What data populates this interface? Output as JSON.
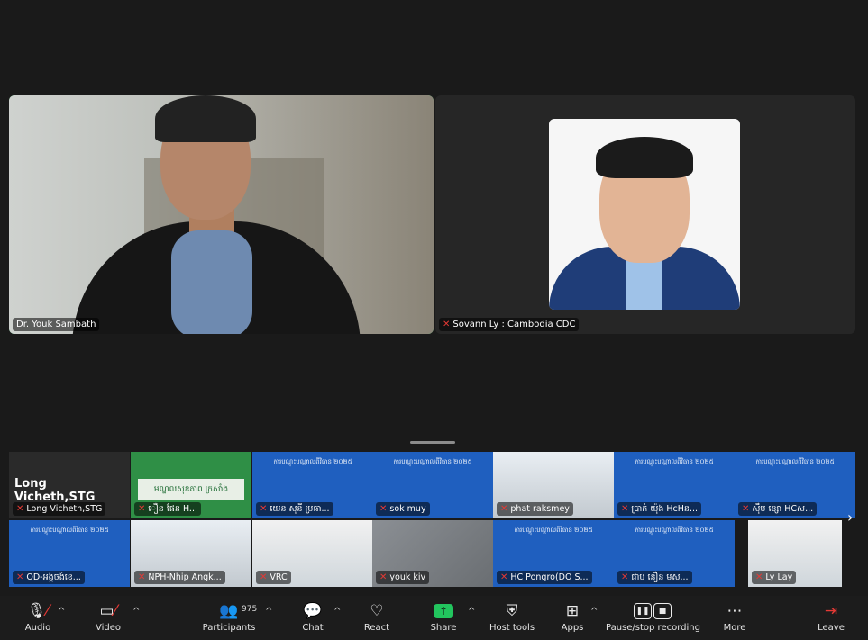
{
  "speakers": [
    {
      "name": "Dr. Youk Sambath",
      "active": true,
      "muted": false
    },
    {
      "name": "Sovann Ly : Cambodia CDC",
      "active": false,
      "muted": true
    }
  ],
  "gallery": [
    {
      "name": "Long Vicheth,STG",
      "big_name": "Long Vicheth,STG",
      "style": "dark"
    },
    {
      "name": "ឿន ផែន        H...",
      "sign": "មណ្ឌលសុខភាព ក្រសាំង",
      "style": "green"
    },
    {
      "name": "យេន សុនី ប្រធា...",
      "banner": "ការបណ្តុះបណ្តាលពីវិធាន ២០២៥",
      "style": "blue"
    },
    {
      "name": "sok muy",
      "banner": "ការបណ្តុះបណ្តាលពីវិធាន ២០២៥",
      "style": "blue"
    },
    {
      "name": "phat raksmey",
      "style": "room"
    },
    {
      "name": "ប្រាក់ យ៉ុង HcHន...",
      "banner": "ការបណ្តុះបណ្តាលពីវិធាន ២០២៥",
      "style": "blue"
    },
    {
      "name": "ស៊ឹម ខ្សោ HCស...",
      "banner": "ការបណ្តុះបណ្តាលពីវិធាន ២០២៥",
      "style": "blue"
    },
    {
      "name": "OD-អង្គចង់ខេ...",
      "banner": "ការបណ្តុះបណ្តាលពីវិធាន ២០២៥",
      "style": "blue"
    },
    {
      "name": "NPH-Nhip Angk...",
      "style": "room"
    },
    {
      "name": "VRC",
      "style": "white-room"
    },
    {
      "name": "youk kiv",
      "style": "blur"
    },
    {
      "name": "HC Pongro(DO S...",
      "banner": "ការបណ្តុះបណ្តាលពីវិធាន ២០២៥",
      "style": "blue"
    },
    {
      "name": "ជាប នឿន មស...",
      "banner": "ការបណ្តុះបណ្តាលពីវិធាន ២០២៥",
      "style": "blue"
    },
    {
      "name": "Ly Lay",
      "style": "white-room"
    }
  ],
  "toolbar": {
    "audio": "Audio",
    "video": "Video",
    "participants": "Participants",
    "participants_count": "975",
    "chat": "Chat",
    "react": "React",
    "share": "Share",
    "host_tools": "Host tools",
    "apps": "Apps",
    "recording": "Pause/stop recording",
    "more": "More",
    "leave": "Leave"
  },
  "colors": {
    "active_speaker": "#2fd36a",
    "share": "#22c55e",
    "muted": "#e53935",
    "banner_blue": "#1f5fbf"
  }
}
